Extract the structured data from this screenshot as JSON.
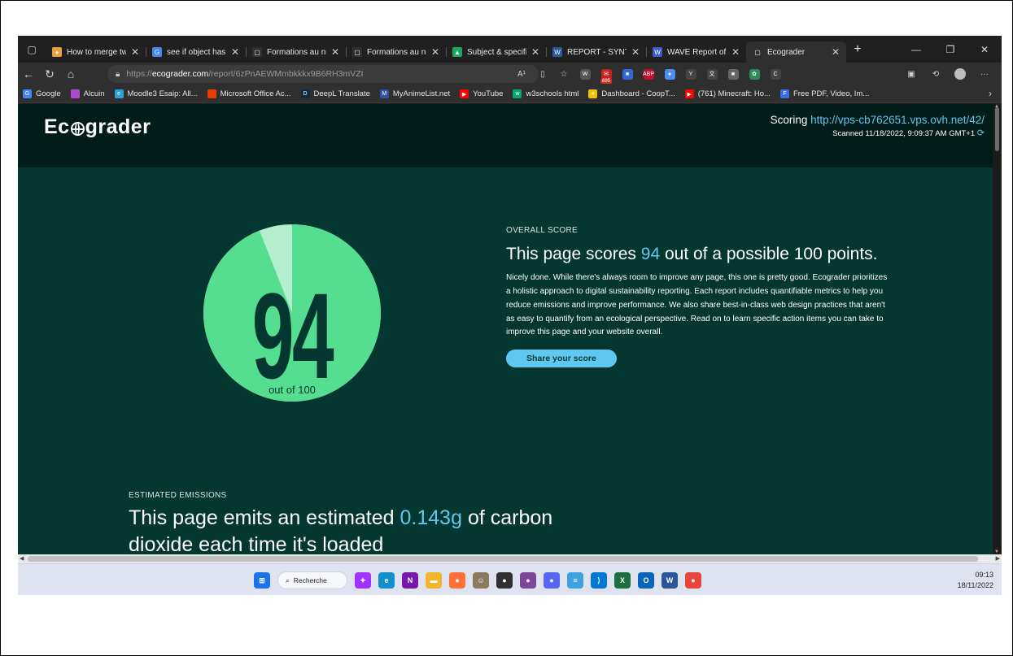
{
  "browser": {
    "tabs": [
      {
        "title": "How to merge tw",
        "favicon_color": "#e8a13a",
        "glyph": "♦"
      },
      {
        "title": "see if object has k",
        "favicon_color": "#4285f4",
        "glyph": "G"
      },
      {
        "title": "Formations au nu",
        "favicon_color": "#2f2f2f",
        "glyph": "▢"
      },
      {
        "title": "Formations au nu",
        "favicon_color": "#2f2f2f",
        "glyph": "▢"
      },
      {
        "title": "Subject & specifi",
        "favicon_color": "#1fa463",
        "glyph": "▲"
      },
      {
        "title": "REPORT - SYNTHE",
        "favicon_color": "#2b579a",
        "glyph": "W"
      },
      {
        "title": "WAVE Report of h",
        "favicon_color": "#3b5bcc",
        "glyph": "W"
      },
      {
        "title": "Ecograder",
        "favicon_color": "#2f2f2f",
        "glyph": "▢",
        "active": true
      }
    ],
    "url": {
      "scheme": "https://",
      "host": "ecograder.com",
      "path": "/report/6zPnAEWMmbkkkx9B6RH3mVZI"
    },
    "bookmarks": [
      {
        "label": "Google",
        "color": "#4285f4",
        "glyph": "G"
      },
      {
        "label": "Alcuin",
        "color": "#b04bc9",
        "glyph": ""
      },
      {
        "label": "Moodle3 Esaip: All...",
        "color": "#2da0d8",
        "glyph": "e"
      },
      {
        "label": "Microsoft Office Ac...",
        "color": "#eb3c00",
        "glyph": ""
      },
      {
        "label": "DeepL Translate",
        "color": "#0f2b46",
        "glyph": "D"
      },
      {
        "label": "MyAnimeList.net",
        "color": "#2e51a2",
        "glyph": "M"
      },
      {
        "label": "YouTube",
        "color": "#ff0000",
        "glyph": "▶"
      },
      {
        "label": "w3schools html",
        "color": "#04aa6d",
        "glyph": "w"
      },
      {
        "label": "Dashboard - CoopT...",
        "color": "#f2c200",
        "glyph": "♦"
      },
      {
        "label": "(761) Minecraft: Ho...",
        "color": "#ff0000",
        "glyph": "▶"
      },
      {
        "label": "Free PDF, Video, Im...",
        "color": "#3a6ee8",
        "glyph": "F"
      }
    ],
    "extensions": [
      {
        "name": "read-aloud",
        "glyph": "A¹"
      },
      {
        "name": "split",
        "glyph": "▯"
      },
      {
        "name": "favorites",
        "glyph": "☆"
      },
      {
        "name": "ext-w",
        "glyph": "W",
        "color": "#555"
      },
      {
        "name": "mail",
        "glyph": "✉",
        "color": "#c5221f",
        "badge": "695"
      },
      {
        "name": "shield",
        "glyph": "■",
        "color": "#3367d6"
      },
      {
        "name": "abp",
        "glyph": "ABP",
        "color": "#c70d2c"
      },
      {
        "name": "chromium",
        "glyph": "●",
        "color": "#4f8cf6"
      },
      {
        "name": "ext-y",
        "glyph": "Y",
        "color": "#444"
      },
      {
        "name": "translate",
        "glyph": "文",
        "color": "#444"
      },
      {
        "name": "ext-game",
        "glyph": "■",
        "color": "#666"
      },
      {
        "name": "ext-leaf",
        "glyph": "✿",
        "color": "#2e8b57"
      },
      {
        "name": "ext-c",
        "glyph": "C",
        "color": "#444"
      }
    ]
  },
  "page": {
    "logo": "Ecograder",
    "scoring_label": "Scoring",
    "scoring_url": "http://vps-cb762651.vps.ovh.net/42/",
    "scanned": "Scanned 11/18/2022, 9:09:37 AM GMT+1",
    "score": {
      "value": 94,
      "max": 100,
      "big_text": "94",
      "caption": "out of 100",
      "fill_color": "#55dd90",
      "remainder_color": "#b4efcd"
    },
    "overall": {
      "eyebrow": "OVERALL SCORE",
      "heading_pre": "This page scores",
      "heading_num": "94",
      "heading_post": "out of a possible 100 points.",
      "body": "Nicely done. While there's always room to improve any page, this one is pretty good. Ecograder prioritizes a holistic approach to digital sustainability reporting. Each report includes quantifiable metrics to help you reduce emissions and improve performance. We also share best-in-class web design practices that aren't as easy to quantify from an ecological perspective. Read on to learn specific action items you can take to improve this page and your website overall.",
      "share_label": "Share your score"
    },
    "emissions": {
      "eyebrow": "ESTIMATED EMISSIONS",
      "heading_pre": "This page emits an estimated",
      "heading_num": "0.143g",
      "heading_post": "of carbon",
      "heading_cut": "dioxide each time it's loaded"
    }
  },
  "taskbar": {
    "search_label": "Recherche",
    "time": "09:13",
    "date": "18/11/2022",
    "apps": [
      {
        "name": "messenger-icon",
        "color": "#a033ff",
        "glyph": "✦"
      },
      {
        "name": "edge-icon",
        "color": "#0f8fcf",
        "glyph": "e"
      },
      {
        "name": "onenote-icon",
        "color": "#7719aa",
        "glyph": "N"
      },
      {
        "name": "file-explorer-icon",
        "color": "#f3b52b",
        "glyph": "▬"
      },
      {
        "name": "firefox-icon",
        "color": "#ff7139",
        "glyph": "●"
      },
      {
        "name": "gimp-icon",
        "color": "#8a7a5e",
        "glyph": "☺"
      },
      {
        "name": "obs-icon",
        "color": "#302e31",
        "glyph": "●"
      },
      {
        "name": "tor-icon",
        "color": "#7d4698",
        "glyph": "●"
      },
      {
        "name": "app-badge-icon",
        "color": "#5865f2",
        "glyph": "●"
      },
      {
        "name": "notepad-icon",
        "color": "#3da3e0",
        "glyph": "≡"
      },
      {
        "name": "vscode-icon",
        "color": "#0078d4",
        "glyph": "⟩"
      },
      {
        "name": "excel-icon",
        "color": "#1d6f42",
        "glyph": "X"
      },
      {
        "name": "outlook-icon",
        "color": "#0a64b8",
        "glyph": "O"
      },
      {
        "name": "word-icon",
        "color": "#2b579a",
        "glyph": "W"
      },
      {
        "name": "chrome-icon",
        "color": "#e8453c",
        "glyph": "●"
      }
    ]
  }
}
